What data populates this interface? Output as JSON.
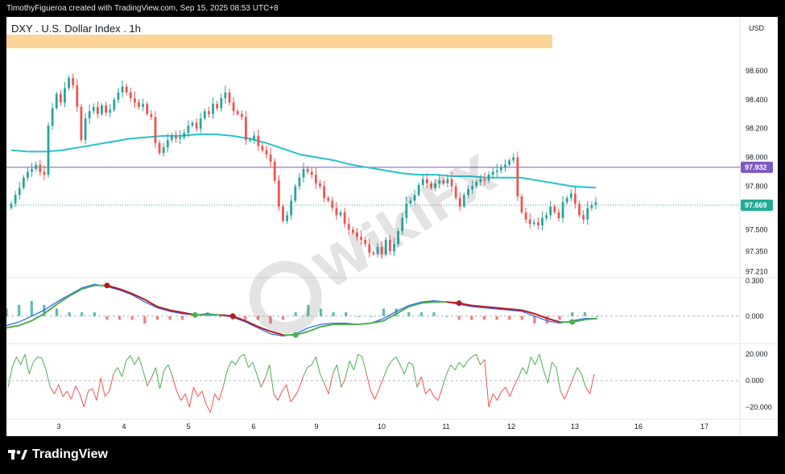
{
  "attribution": "TimothyFigueroa created with TradingView.com, Sep 15, 2025 08:53 UTC+8",
  "symbol": {
    "title": "DXY . U.S. Dollar Index . 1h",
    "currency": "USD"
  },
  "watermark": {
    "text": "WikiFX",
    "logo_icon": "wikifx-eagle-icon"
  },
  "brand": {
    "name": "TradingView",
    "logo_icon": "tradingview-logo-icon"
  },
  "colors": {
    "up": "#26a69a",
    "down": "#ef5350",
    "ma": "#27c2c9",
    "horizontal_line": "#7e57c2",
    "last_price": "#22ab94",
    "banner": "#fcd497",
    "macd_fast": "#2962ff",
    "macd_signal_up": "#4caf50",
    "macd_signal_down": "#b71c1c"
  },
  "chart_data": [
    {
      "type": "candlestick",
      "title": "DXY . U.S. Dollar Index . 1h",
      "unit": "USD",
      "x_labels": [
        "3",
        "4",
        "5",
        "6",
        "9",
        "10",
        "11",
        "12",
        "13",
        "16",
        "17"
      ],
      "y_ticks": [
        98.6,
        98.4,
        98.2,
        98.0,
        97.8,
        97.5,
        97.35,
        97.21
      ],
      "y_tick_labels": [
        "98.600",
        "98.400",
        "98.200",
        "98.000",
        "97.800",
        "97.500",
        "97.350",
        "97.210"
      ],
      "ylim": [
        97.19,
        98.75
      ],
      "price_tags": [
        {
          "label": "97.932",
          "value": 97.932,
          "kind": "horizontal-line"
        },
        {
          "label": "97.669",
          "value": 97.669,
          "kind": "last-price"
        }
      ],
      "moving_average": {
        "x": [
          0,
          5,
          10,
          15,
          20,
          25,
          30,
          35,
          40,
          45,
          50,
          55,
          60,
          65,
          70,
          75,
          80,
          85,
          90,
          95,
          100,
          105,
          110,
          115,
          120,
          125,
          130,
          135,
          140,
          145,
          150,
          155,
          160,
          165,
          172
        ],
        "values": [
          98.05,
          98.04,
          98.04,
          98.05,
          98.07,
          98.09,
          98.11,
          98.13,
          98.14,
          98.15,
          98.15,
          98.16,
          98.16,
          98.15,
          98.13,
          98.1,
          98.06,
          98.02,
          98.0,
          97.98,
          97.95,
          97.93,
          97.91,
          97.89,
          97.88,
          97.88,
          97.87,
          97.87,
          97.86,
          97.86,
          97.86,
          97.84,
          97.82,
          97.8,
          97.79
        ]
      },
      "close": [
        97.68,
        97.74,
        97.79,
        97.86,
        97.9,
        97.92,
        97.95,
        97.9,
        97.88,
        98.22,
        98.34,
        98.44,
        98.38,
        98.48,
        98.55,
        98.5,
        98.35,
        98.12,
        98.27,
        98.32,
        98.35,
        98.3,
        98.36,
        98.31,
        98.33,
        98.4,
        98.45,
        98.49,
        98.45,
        98.41,
        98.38,
        98.35,
        98.37,
        98.3,
        98.28,
        98.1,
        98.03,
        98.07,
        98.12,
        98.15,
        98.13,
        98.14,
        98.17,
        98.22,
        98.24,
        98.2,
        98.27,
        98.32,
        98.3,
        98.37,
        98.34,
        98.41,
        98.45,
        98.38,
        98.32,
        98.3,
        98.28,
        98.12,
        98.12,
        98.15,
        98.08,
        98.05,
        98.02,
        97.97,
        97.84,
        97.66,
        97.56,
        97.6,
        97.7,
        97.8,
        97.86,
        97.92,
        97.9,
        97.88,
        97.82,
        97.8,
        97.72,
        97.7,
        97.65,
        97.6,
        97.62,
        97.54,
        97.5,
        97.48,
        97.45,
        97.43,
        97.4,
        97.34,
        97.33,
        97.38,
        97.33,
        97.43,
        97.35,
        97.4,
        97.49,
        97.58,
        97.68,
        97.7,
        97.74,
        97.81,
        97.85,
        97.82,
        97.79,
        97.82,
        97.84,
        97.82,
        97.85,
        97.8,
        97.72,
        97.66,
        97.74,
        97.78,
        97.8,
        97.83,
        97.85,
        97.84,
        97.88,
        97.9,
        97.91,
        97.93,
        97.95,
        97.98,
        98.0,
        97.73,
        97.62,
        97.57,
        97.54,
        97.55,
        97.53,
        97.58,
        97.6,
        97.66,
        97.62,
        97.58,
        97.69,
        97.72,
        97.75,
        97.68,
        97.6,
        97.57,
        97.65,
        97.67,
        97.69
      ],
      "candle_count": 140,
      "note_x": "bar index 0 to 139, hourly bars"
    },
    {
      "type": "macd",
      "y_ticks": [
        0.3,
        0.0
      ],
      "y_tick_labels": [
        "0.300",
        "0.000"
      ],
      "ylim": [
        -0.22,
        0.34
      ],
      "macd_line": [
        -0.08,
        -0.05,
        0.0,
        0.05,
        0.12,
        0.18,
        0.24,
        0.27,
        0.25,
        0.22,
        0.18,
        0.12,
        0.07,
        0.04,
        0.02,
        0.01,
        0.02,
        0.01,
        -0.01,
        -0.05,
        -0.1,
        -0.15,
        -0.17,
        -0.15,
        -0.1,
        -0.07,
        -0.06,
        -0.06,
        -0.07,
        -0.06,
        -0.02,
        0.04,
        0.09,
        0.12,
        0.13,
        0.12,
        0.1,
        0.08,
        0.07,
        0.06,
        0.05,
        0.04,
        0.0,
        -0.04,
        -0.06,
        -0.04,
        -0.02,
        -0.02
      ],
      "signal_line": [
        -0.1,
        -0.08,
        -0.04,
        0.02,
        0.1,
        0.17,
        0.23,
        0.26,
        0.26,
        0.23,
        0.19,
        0.14,
        0.08,
        0.05,
        0.03,
        0.01,
        0.01,
        0.01,
        0.0,
        -0.04,
        -0.09,
        -0.13,
        -0.16,
        -0.16,
        -0.13,
        -0.09,
        -0.07,
        -0.07,
        -0.07,
        -0.06,
        -0.04,
        0.02,
        0.08,
        0.11,
        0.12,
        0.12,
        0.11,
        0.09,
        0.08,
        0.07,
        0.06,
        0.05,
        0.02,
        -0.02,
        -0.05,
        -0.05,
        -0.03,
        -0.02
      ],
      "signal_line_count": 48
    },
    {
      "type": "oscillator",
      "y_ticks": [
        20.0,
        0.0,
        -20.0
      ],
      "y_tick_labels": [
        "20.000",
        "0.000",
        "−20.000"
      ],
      "ylim": [
        -28,
        28
      ],
      "values": [
        -5,
        10,
        18,
        12,
        20,
        5,
        14,
        18,
        17,
        8,
        -5,
        -10,
        -3,
        -12,
        -8,
        -14,
        -4,
        -10,
        -20,
        -8,
        -6,
        -15,
        2,
        -12,
        -8,
        5,
        10,
        3,
        15,
        19,
        12,
        18,
        8,
        -4,
        2,
        10,
        -6,
        8,
        12,
        3,
        -8,
        -15,
        -10,
        -20,
        -5,
        -12,
        -8,
        -18,
        -24,
        -10,
        -15,
        -5,
        8,
        15,
        12,
        18,
        20,
        10,
        14,
        5,
        -5,
        2,
        12,
        -10,
        -15,
        -8,
        -3,
        -16,
        -12,
        -6,
        3,
        10,
        12,
        18,
        5,
        -2,
        -10,
        5,
        12,
        -5,
        2,
        15,
        8,
        20,
        18,
        5,
        -8,
        -14,
        -6,
        2,
        10,
        15,
        18,
        12,
        5,
        14,
        12,
        -5,
        3,
        -10,
        -6,
        -12,
        -15,
        -5,
        5,
        12,
        8,
        14,
        10,
        15,
        18,
        20,
        12,
        16,
        -20,
        -10,
        -15,
        -8,
        -5,
        -12,
        -4,
        2,
        10,
        5,
        18,
        12,
        20,
        8,
        -2,
        14,
        10,
        -8,
        -14,
        -6,
        2,
        10,
        5,
        -5,
        -10,
        5
      ],
      "values_count": 140
    }
  ]
}
